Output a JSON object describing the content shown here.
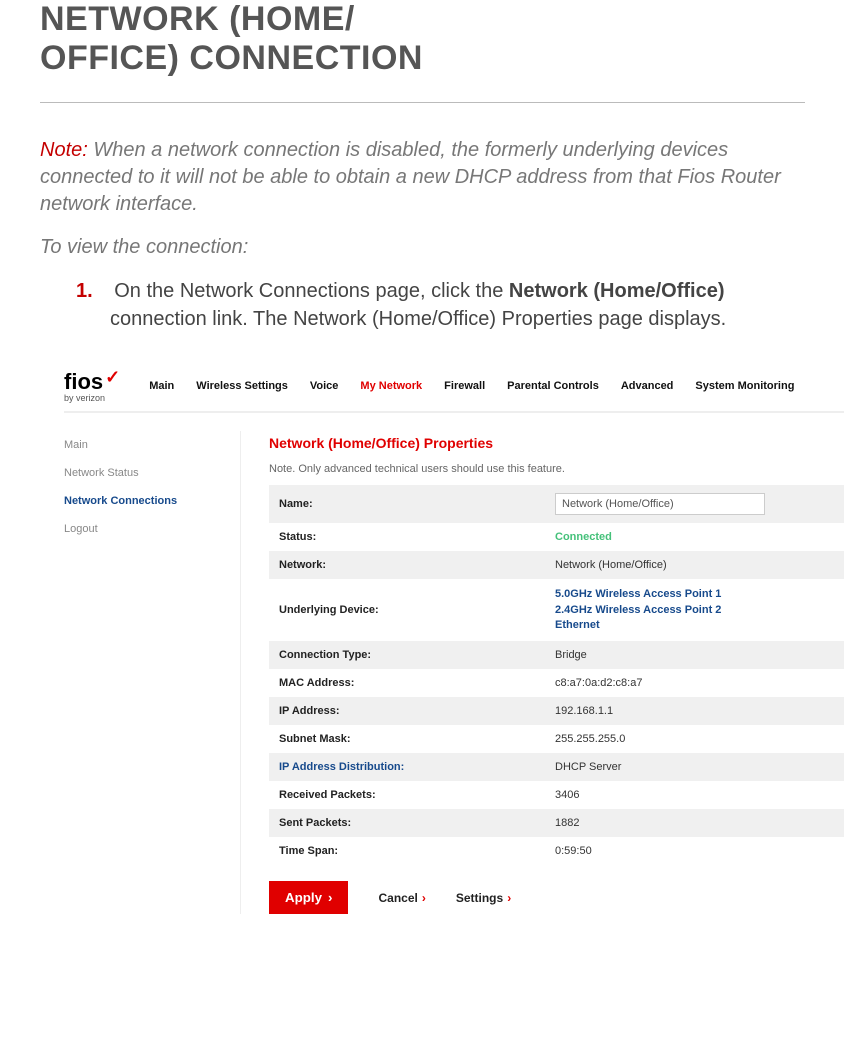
{
  "doc": {
    "title": "NETWORK (HOME/\nOFFICE) CONNECTION",
    "note_word": "Note:",
    "note_text": "When a network connection is disabled, the formerly underlying devices connected to it will not be able to obtain a new DHCP address from that Fios Router network interface.",
    "intro": "To view the connection:",
    "step_num": "1.",
    "step_pre": "On the Network Connections page, click the ",
    "step_bold": "Network (Home/Office)",
    "step_post": " connection link. The Network (Home/Office) Properties page displays."
  },
  "ui": {
    "logo_main": "fios",
    "logo_sub": "by verizon",
    "nav": [
      "Main",
      "Wireless Settings",
      "Voice",
      "My Network",
      "Firewall",
      "Parental Controls",
      "Advanced",
      "System Monitoring"
    ],
    "nav_active_index": 3,
    "sidebar": [
      "Main",
      "Network Status",
      "Network Connections",
      "Logout"
    ],
    "sidebar_active_index": 2,
    "panel_title": "Network (Home/Office) Properties",
    "panel_note": "Note. Only advanced technical users should use this feature.",
    "rows": [
      {
        "label": "Name:",
        "type": "input",
        "value": "Network (Home/Office)"
      },
      {
        "label": "Status:",
        "type": "status",
        "value": "Connected"
      },
      {
        "label": "Network:",
        "type": "text",
        "value": "Network (Home/Office)"
      },
      {
        "label": "Underlying Device:",
        "type": "links",
        "links": [
          "5.0GHz Wireless Access Point 1",
          "2.4GHz Wireless Access Point 2",
          "Ethernet"
        ]
      },
      {
        "label": "Connection Type:",
        "type": "text",
        "value": "Bridge"
      },
      {
        "label": "MAC Address:",
        "type": "text",
        "value": "c8:a7:0a:d2:c8:a7"
      },
      {
        "label": "IP Address:",
        "type": "text",
        "value": "192.168.1.1"
      },
      {
        "label": "Subnet Mask:",
        "type": "text",
        "value": "255.255.255.0"
      },
      {
        "label": "IP Address Distribution:",
        "type": "text",
        "value": "DHCP Server",
        "label_link": true
      },
      {
        "label": "Received Packets:",
        "type": "text",
        "value": "3406"
      },
      {
        "label": "Sent Packets:",
        "type": "text",
        "value": "1882"
      },
      {
        "label": "Time Span:",
        "type": "text",
        "value": "0:59:50"
      }
    ],
    "actions": {
      "apply": "Apply",
      "cancel": "Cancel",
      "settings": "Settings"
    }
  }
}
